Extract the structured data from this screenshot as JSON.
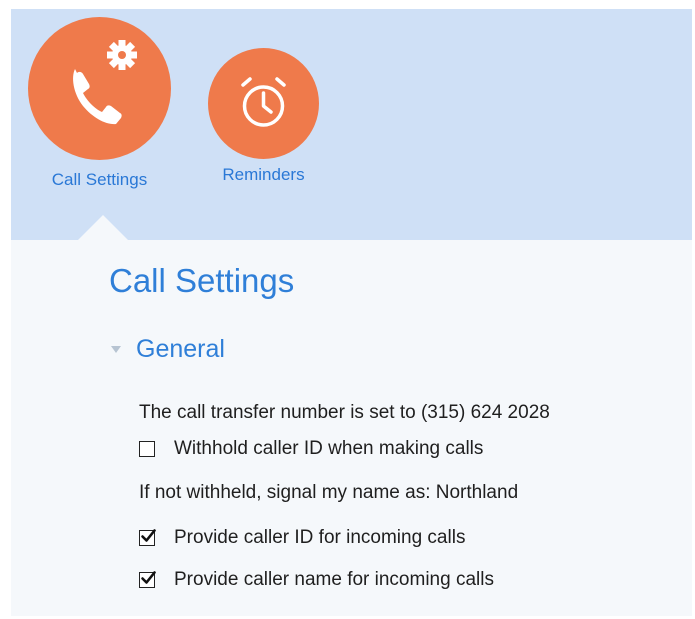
{
  "tabs": [
    {
      "label": "Call Settings",
      "icon": "phone-gear-icon",
      "selected": true
    },
    {
      "label": "Reminders",
      "icon": "alarm-clock-icon",
      "selected": false
    }
  ],
  "page": {
    "title": "Call Settings"
  },
  "section": {
    "title": "General",
    "expanded": true
  },
  "settings": {
    "transfer_text": "The call transfer number is set to (315) 624 2028",
    "withhold_caller_id": {
      "label": "Withhold caller ID when making calls",
      "checked": false
    },
    "signal_name_text": "If not withheld, signal my name as: Northland",
    "provide_caller_id": {
      "label": "Provide caller ID for incoming calls",
      "checked": true
    },
    "provide_caller_name": {
      "label": "Provide caller name for incoming calls",
      "checked": true
    }
  },
  "colors": {
    "accent_orange": "#ef7a4b",
    "link_blue": "#2f7fd8",
    "header_band": "#cfe0f6",
    "content_bg": "#f5f8fb"
  }
}
